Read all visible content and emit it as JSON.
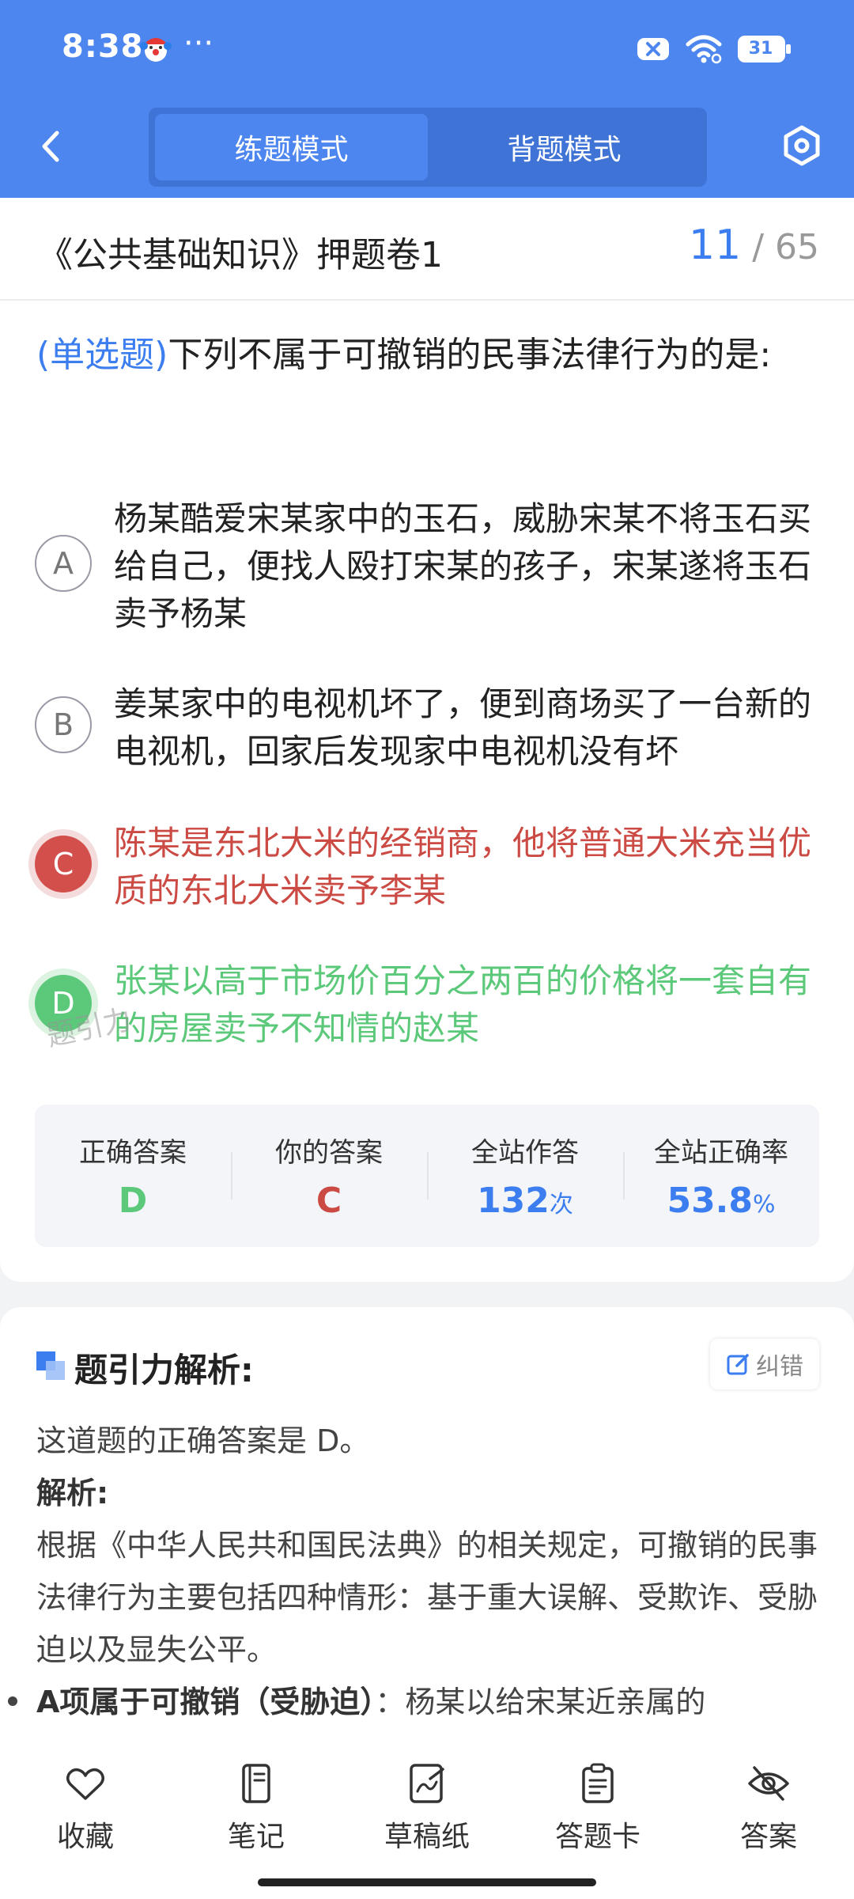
{
  "status_bar": {
    "time": "8:38",
    "dots": "···",
    "battery": "31"
  },
  "header": {
    "modes": [
      {
        "label": "练题模式",
        "active": true
      },
      {
        "label": "背题模式",
        "active": false
      }
    ]
  },
  "paper": {
    "title": "《公共基础知识》押题卷1",
    "current": "11",
    "total": "/ 65"
  },
  "question": {
    "type": "(单选题)",
    "text": "下列不属于可撤销的民事法律行为的是:",
    "options": [
      {
        "letter": "A",
        "text": "杨某酷爱宋某家中的玉石，威胁宋某不将玉石买给自己，便找人殴打宋某的孩子，宋某遂将玉石卖予杨某"
      },
      {
        "letter": "B",
        "text": "姜某家中的电视机坏了，便到商场买了一台新的电视机，回家后发现家中电视机没有坏"
      },
      {
        "letter": "C",
        "text": "陈某是东北大米的经销商，他将普通大米充当优质的东北大米卖予李某"
      },
      {
        "letter": "D",
        "text": "张某以高于市场价百分之两百的价格将一套自有的房屋卖予不知情的赵某"
      }
    ],
    "watermark": "题引力"
  },
  "stats": {
    "correct_label": "正确答案",
    "correct_value": "D",
    "yours_label": "你的答案",
    "yours_value": "C",
    "count_label": "全站作答",
    "count_value": "132",
    "count_unit": "次",
    "rate_label": "全站正确率",
    "rate_value": "53.8",
    "rate_unit": "%"
  },
  "analysis": {
    "title": "题引力解析:",
    "correct_btn": "纠错",
    "line1": "这道题的正确答案是 D。",
    "line2": "解析:",
    "line3": "根据《中华人民共和国民法典》的相关规定，可撤销的民事法律行为主要包括四种情形：基于重大误解、受欺诈、受胁迫以及显失公平。",
    "bullet_strong": "A项属于可撤销（受胁迫）",
    "bullet_rest": "：杨某以给宋某近亲属的"
  },
  "toolbar": {
    "items": [
      {
        "label": "收藏",
        "icon": "heart-icon"
      },
      {
        "label": "笔记",
        "icon": "notebook-icon"
      },
      {
        "label": "草稿纸",
        "icon": "draft-icon"
      },
      {
        "label": "答题卡",
        "icon": "answer-card-icon"
      },
      {
        "label": "答案",
        "icon": "eye-off-icon"
      }
    ]
  },
  "colors": {
    "primary": "#4d86ef",
    "correct": "#5cc97a",
    "wrong": "#cc4a44",
    "accent": "#3c7ef0"
  }
}
